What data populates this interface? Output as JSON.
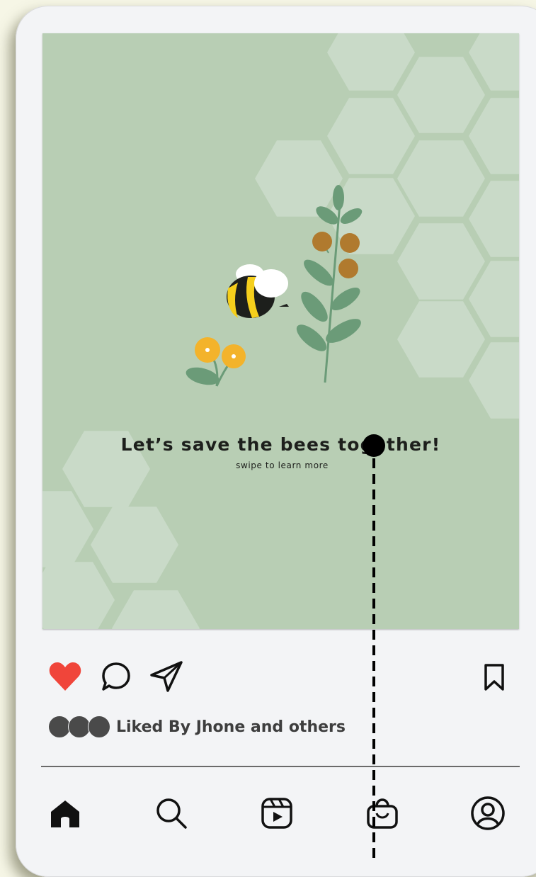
{
  "post": {
    "headline": "Let’s save the bees together!",
    "subline": "swipe to learn more",
    "background_color": "#b8ceb4",
    "hexagon_color": "#c9dac8"
  },
  "actions": {
    "like_icon": "heart-filled-icon",
    "like_color": "#f0453a",
    "comment_icon": "speech-bubble-icon",
    "share_icon": "paper-plane-icon",
    "save_icon": "bookmark-icon",
    "liked": true
  },
  "likes": {
    "text": "Liked By Jhone and others"
  },
  "bottom_nav": {
    "items": [
      {
        "name": "home",
        "icon": "home-icon",
        "active": true
      },
      {
        "name": "search",
        "icon": "search-icon"
      },
      {
        "name": "reels",
        "icon": "reels-icon"
      },
      {
        "name": "shop",
        "icon": "shopping-bag-icon"
      },
      {
        "name": "profile",
        "icon": "profile-icon"
      }
    ]
  }
}
